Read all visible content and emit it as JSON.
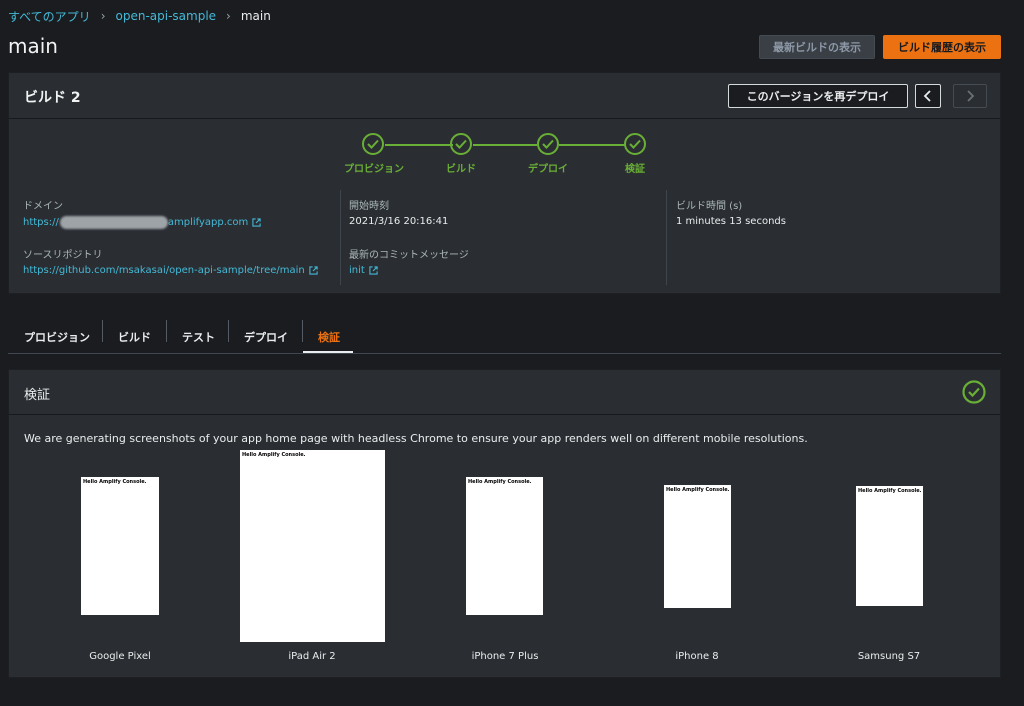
{
  "breadcrumb": {
    "all_apps": "すべてのアプリ",
    "app": "open-api-sample",
    "branch": "main"
  },
  "page_title": "main",
  "header_buttons": {
    "latest_build": "最新ビルドの表示",
    "build_history": "ビルド履歴の表示"
  },
  "build": {
    "title": "ビルド 2",
    "redeploy": "このバージョンを再デプロイ",
    "steps": [
      "プロビジョン",
      "ビルド",
      "デプロイ",
      "検証"
    ],
    "domain_label": "ドメイン",
    "domain_value": "https://",
    "domain_suffix": "amplifyapp.com",
    "repo_label": "ソースリポジトリ",
    "repo_value": "https://github.com/msakasai/open-api-sample/tree/main",
    "start_label": "開始時刻",
    "start_value": "2021/3/16 20:16:41",
    "commit_label": "最新のコミットメッセージ",
    "commit_value": "init",
    "duration_label": "ビルド時間 (s)",
    "duration_value": "1 minutes 13 seconds"
  },
  "tabs": [
    "プロビジョン",
    "ビルド",
    "テスト",
    "デプロイ",
    "検証"
  ],
  "verify": {
    "title": "検証",
    "description": "We are generating screenshots of your app home page with headless Chrome to ensure your app renders well on different mobile resolutions.",
    "shot_text": "Hello Amplify Console.",
    "devices": [
      "Google Pixel",
      "iPad Air 2",
      "iPhone 7 Plus",
      "iPhone 8",
      "Samsung S7"
    ]
  },
  "colors": {
    "accent": "#ec7211",
    "success": "#6aaf35",
    "link": "#44b9d6"
  }
}
